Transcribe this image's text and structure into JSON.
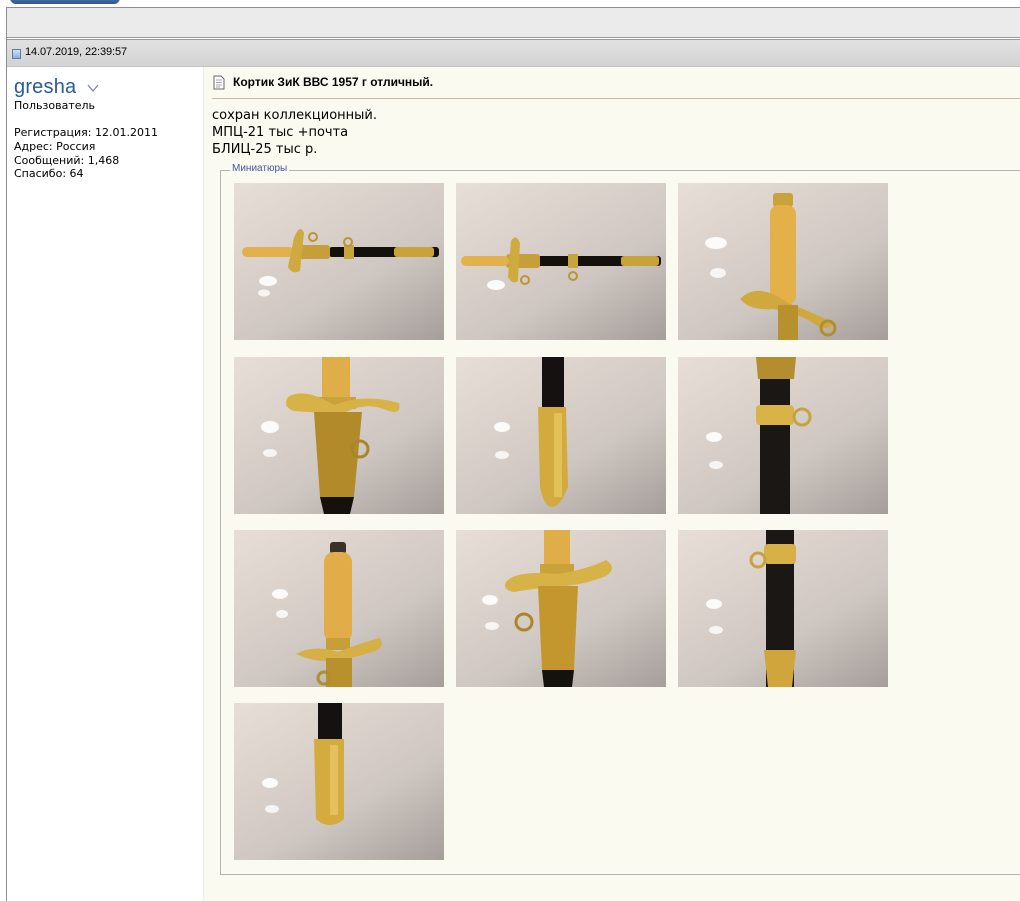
{
  "post": {
    "date": "14.07.2019, 22:39:57",
    "title": "Кортик ЗиК ВВС 1957 г отличный.",
    "body_lines": [
      "сохран коллекционный.",
      "МПЦ-21 тыс +почта",
      "БЛИЦ-25 тыс р."
    ]
  },
  "user": {
    "name": "gresha",
    "title": "Пользователь",
    "registration": "Регистрация: 12.01.2011",
    "address": "Адрес: Россия",
    "messages": "Сообщений: 1,468",
    "thanks": "Спасибо: 64"
  },
  "attachments": {
    "legend": "Миниатюры",
    "thumbnails": [
      {
        "name": "dagger-full-sheathed-photo"
      },
      {
        "name": "dagger-full-sheathed-photo-2"
      },
      {
        "name": "dagger-handle-closeup-photo"
      },
      {
        "name": "dagger-crossguard-closeup-photo"
      },
      {
        "name": "scabbard-tip-photo"
      },
      {
        "name": "scabbard-ring-photo"
      },
      {
        "name": "dagger-handle-top-photo"
      },
      {
        "name": "dagger-guard-ring-photo"
      },
      {
        "name": "scabbard-full-photo"
      },
      {
        "name": "scabbard-tip-photo-2"
      }
    ]
  },
  "colors": {
    "username": "#2b5a9a",
    "content_bg": "#fbfaf1",
    "legend": "#3d58a8",
    "date_bar": "#d8d8d8"
  }
}
